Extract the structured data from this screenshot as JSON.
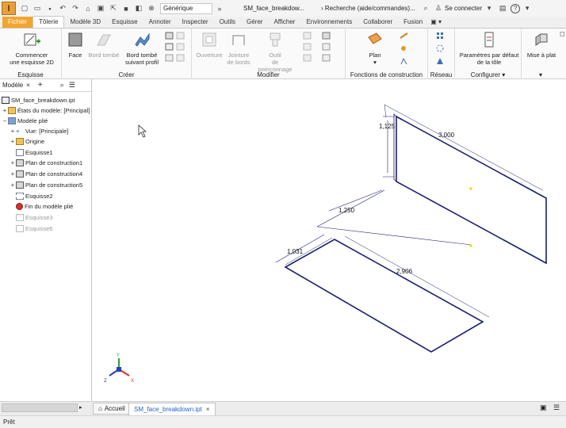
{
  "titlebar": {
    "style_combo": "Générique",
    "document_title": "SM_face_breakdow...",
    "search_placeholder": "Recherche (aide/commandes)...",
    "sign_in": "Se connecter",
    "help": "?"
  },
  "tabs": [
    "Fichier",
    "Tôlerie",
    "Modèle 3D",
    "Esquisse",
    "Annoter",
    "Inspecter",
    "Outils",
    "Gérer",
    "Afficher",
    "Environnements",
    "Collaborer",
    "Fusion"
  ],
  "ribbon": {
    "sketch_panel": {
      "label": "Esquisse",
      "btn_line1": "Commencer",
      "btn_line2": "une esquisse 2D"
    },
    "create_panel": {
      "label": "Créer",
      "face": "Face",
      "edge_flange": "Bord tombé",
      "contour_flange_1": "Bord tombé",
      "contour_flange_2": "suivant profil"
    },
    "modify_panel": {
      "label": "Modifier",
      "cut": "Ouverture",
      "corner_seam_1": "Jointure",
      "corner_seam_2": "de bords",
      "punch_1": "Outil",
      "punch_2": "de poinçonnage"
    },
    "flat_panel": {
      "label": "Fonctions de construction",
      "plan": "Plan"
    },
    "network_panel": {
      "label": "Réseau"
    },
    "setup_panel": {
      "label": "Configurer",
      "params_1": "Paramètres par défaut",
      "params_2": "de la tôle"
    },
    "flat_pattern": {
      "line1": "Mise à plat"
    }
  },
  "browser": {
    "title": "Modèle",
    "items": [
      {
        "label": "SM_face_breakdown.ipt",
        "level": 0
      },
      {
        "label": "États du modèle: [Principal]",
        "level": 0
      },
      {
        "label": "Modèle plié",
        "level": 0
      },
      {
        "label": "Vue: [Principale]",
        "level": 1
      },
      {
        "label": "Origine",
        "level": 1
      },
      {
        "label": "Esquisse1",
        "level": 1
      },
      {
        "label": "Plan de construction1",
        "level": 1
      },
      {
        "label": "Plan de construction4",
        "level": 1
      },
      {
        "label": "Plan de construction5",
        "level": 1
      },
      {
        "label": "Esquisse2",
        "level": 1
      },
      {
        "label": "Fin du modèle plié",
        "level": 1
      },
      {
        "label": "Esquisse3",
        "level": 1
      },
      {
        "label": "Esquisse6",
        "level": 1
      }
    ]
  },
  "dimensions": {
    "height_1": "1,125",
    "width_1": "3,000",
    "offset_1": "1,250",
    "depth_1": "1,031",
    "length_1": "2,906"
  },
  "triad": {
    "x": "X",
    "y": "Y",
    "z": "Z"
  },
  "doc_tabs": {
    "home": "Accueil",
    "document": "SM_face_breakdown.ipt"
  },
  "status": "Prêt",
  "colors": {
    "accent": "#f2a52e",
    "sketch_line": "#1a1f6e",
    "dim_line": "#1a1f6e",
    "point": "#f2d000",
    "active_tab_text": "#2a62c4"
  }
}
